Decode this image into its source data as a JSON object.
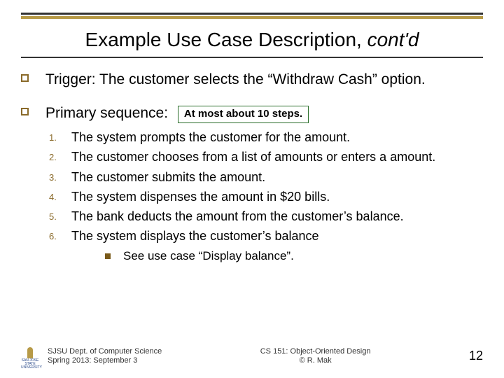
{
  "title": {
    "main": "Example Use Case Description, ",
    "italic": "cont'd"
  },
  "trigger": {
    "label": "Trigger:",
    "text": "The customer selects the “Withdraw Cash” option."
  },
  "primary": {
    "label": "Primary sequence:",
    "callout": "At most about 10 steps.",
    "steps": [
      "The system prompts the customer for the amount.",
      "The customer chooses from a list of amounts or enters a amount.",
      "The customer submits the amount.",
      "The system dispenses the amount in $20 bills.",
      "The bank deducts the amount from the customer’s balance.",
      "The system displays the customer’s balance"
    ],
    "sub": "See use case “Display balance”."
  },
  "footer": {
    "left1": "SJSU Dept. of Computer Science",
    "left2": "Spring 2013: September 3",
    "center1": "CS 151: Object-Oriented Design",
    "center2": "© R. Mak",
    "page": "12",
    "logo_alt": "SAN JOSE STATE UNIVERSITY"
  }
}
